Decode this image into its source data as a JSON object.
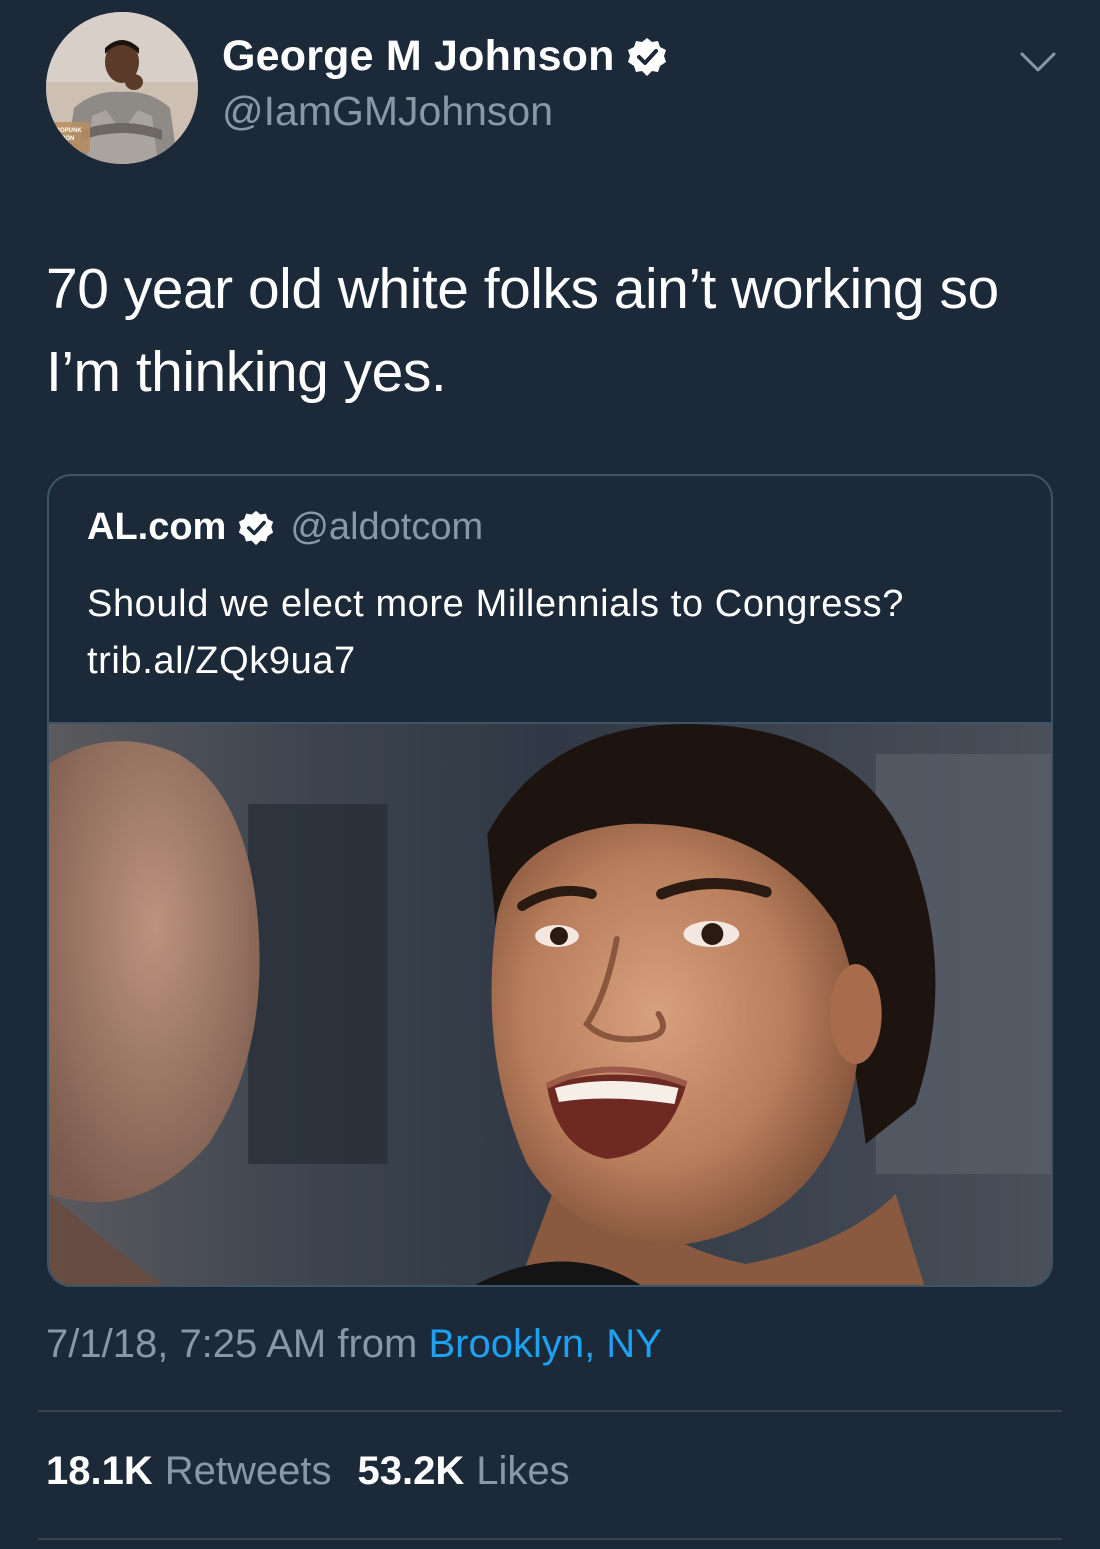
{
  "author": {
    "display_name": "George M Johnson",
    "handle": "@IamGMJohnson",
    "verified": true,
    "avatar_text": "AFROPUNK SOLUTION SESSIONS"
  },
  "menu": {
    "icon": "chevron-down-icon"
  },
  "tweet": {
    "text": "70 year old white folks ain’t working so I’m thinking yes."
  },
  "quoted_tweet": {
    "display_name": "AL.com",
    "handle": "@aldotcom",
    "verified": true,
    "text": "Should we elect more Millennials to Congress? trib.al/ZQk9ua7"
  },
  "meta": {
    "timestamp": "7/1/18, 7:25 AM",
    "from_label": "from",
    "location": "Brooklyn, NY"
  },
  "stats": {
    "retweets_count": "18.1K",
    "retweets_label": "Retweets",
    "likes_count": "53.2K",
    "likes_label": "Likes"
  },
  "colors": {
    "background": "#1c2938",
    "secondary_text": "#8899a6",
    "link": "#1da1f2",
    "border": "#3d5466",
    "verified_badge": "#ffffff"
  }
}
